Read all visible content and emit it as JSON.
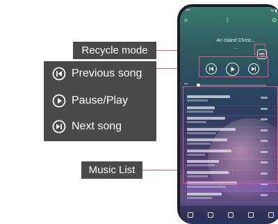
{
  "annotations": {
    "recycle_mode": "Recycle mode",
    "previous_song": "Previous song",
    "pause_play": "Pause/Play",
    "next_song": "Next song",
    "music_list": "Music List"
  },
  "phone": {
    "now_playing_title": "An Island Christ...",
    "repeat_mode_icon": "repeat-icon",
    "rows": 10,
    "highlighted_row_index": 8
  },
  "colors": {
    "callout": "#e15b79",
    "label_bg": "#4a4a4a"
  }
}
